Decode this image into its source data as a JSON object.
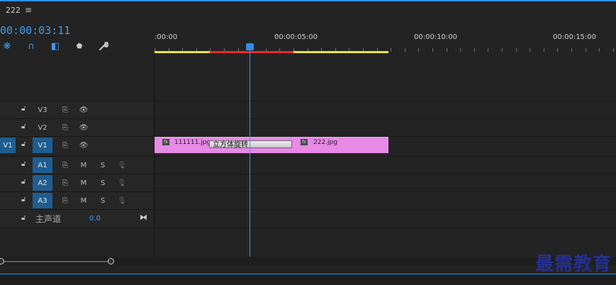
{
  "sequence": {
    "tab_name": "222",
    "menu_icon": "hamburger-menu-icon"
  },
  "timecode": "00:00:03:11",
  "tools": [
    {
      "icon": "snap-icon",
      "glyph": "❋"
    },
    {
      "icon": "linked-selection-icon",
      "glyph": "∩"
    },
    {
      "icon": "add-marker-icon",
      "glyph": "◧"
    },
    {
      "icon": "marker-icon",
      "glyph": "⬟"
    },
    {
      "icon": "wrench-icon",
      "glyph": "🔧"
    }
  ],
  "ruler": {
    "labels": [
      ":00:00",
      "00:00:05:00",
      "00:00:10:00",
      "00:00:15:00"
    ]
  },
  "tracks": {
    "video": [
      {
        "name": "V3",
        "target": "",
        "selected": false
      },
      {
        "name": "V2",
        "target": "",
        "selected": false
      },
      {
        "name": "V1",
        "target": "V1",
        "selected": true
      }
    ],
    "audio": [
      {
        "name": "A1",
        "mute": "M",
        "solo": "S"
      },
      {
        "name": "A2",
        "mute": "M",
        "solo": "S"
      },
      {
        "name": "A3",
        "mute": "M",
        "solo": "S"
      }
    ],
    "master": {
      "label": "主声道",
      "value": "0.0"
    }
  },
  "clips": [
    {
      "name": "111111.jpg",
      "fx": "fx"
    },
    {
      "name": "222.jpg",
      "fx": "fx"
    }
  ],
  "transition": {
    "label": "立方体旋转"
  },
  "watermark": "最需教育",
  "colors": {
    "accent": "#2d8ceb",
    "clip": "#e68ae6",
    "selected_track": "#1f5d91",
    "workbar_yellow": "#ebe24c",
    "workbar_red": "#e62d2d"
  }
}
